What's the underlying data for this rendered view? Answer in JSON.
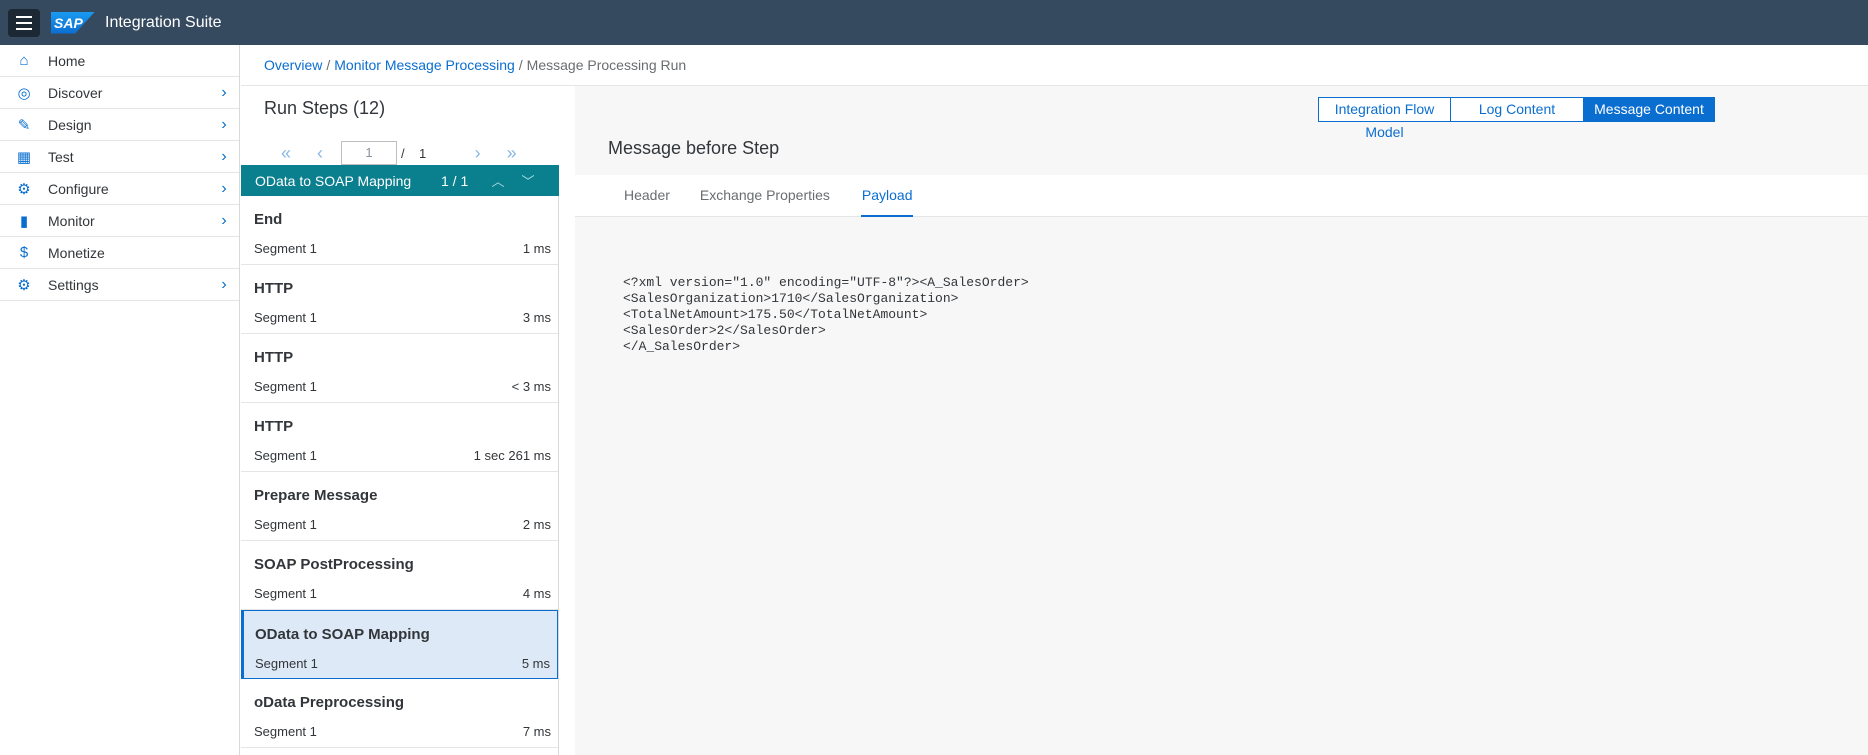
{
  "shell": {
    "title": "Integration Suite",
    "logo_text": "SAP"
  },
  "sidenav": {
    "items": [
      {
        "label": "Home",
        "icon": "home-icon",
        "glyph": "⌂",
        "chevron": false
      },
      {
        "label": "Discover",
        "icon": "compass-icon",
        "glyph": "◎",
        "chevron": true
      },
      {
        "label": "Design",
        "icon": "pencil-icon",
        "glyph": "✎",
        "chevron": true
      },
      {
        "label": "Test",
        "icon": "calculator-icon",
        "glyph": "▦",
        "chevron": true
      },
      {
        "label": "Configure",
        "icon": "sliders-icon",
        "glyph": "⚙",
        "chevron": true
      },
      {
        "label": "Monitor",
        "icon": "bar-chart-icon",
        "glyph": "▮",
        "chevron": true
      },
      {
        "label": "Monetize",
        "icon": "dollar-icon",
        "glyph": "$",
        "chevron": false
      },
      {
        "label": "Settings",
        "icon": "gear-icon",
        "glyph": "⚙",
        "chevron": true
      }
    ]
  },
  "breadcrumb": {
    "overview": "Overview",
    "monitor": "Monitor Message Processing",
    "sep": "/",
    "current": "Message Processing Run"
  },
  "steps": {
    "title": "Run Steps (12)",
    "pager": {
      "page_value": "1",
      "slash": "/",
      "total": "1"
    },
    "group": {
      "name": "OData to SOAP Mapping",
      "count": "1 / 1"
    },
    "items": [
      {
        "name": "End",
        "segment": "Segment 1",
        "time": "1 ms"
      },
      {
        "name": "HTTP",
        "segment": "Segment 1",
        "time": "3 ms"
      },
      {
        "name": "HTTP",
        "segment": "Segment 1",
        "time": "< 3 ms"
      },
      {
        "name": "HTTP",
        "segment": "Segment 1",
        "time": "1 sec 261 ms"
      },
      {
        "name": "Prepare Message",
        "segment": "Segment 1",
        "time": "2 ms"
      },
      {
        "name": "SOAP PostProcessing",
        "segment": "Segment 1",
        "time": "4 ms"
      },
      {
        "name": "OData to SOAP Mapping",
        "segment": "Segment 1",
        "time": "5 ms",
        "selected": true
      },
      {
        "name": "oData Preprocessing",
        "segment": "Segment 1",
        "time": "7 ms"
      }
    ]
  },
  "content": {
    "view_buttons": [
      "Integration Flow Model",
      "Log Content",
      "Message Content"
    ],
    "active_view": "Message Content",
    "message_title": "Message before Step",
    "tabs": [
      "Header",
      "Exchange Properties",
      "Payload"
    ],
    "active_tab": "Payload",
    "payload": "<?xml version=\"1.0\" encoding=\"UTF-8\"?><A_SalesOrder>\n<SalesOrganization>1710</SalesOrganization>\n<TotalNetAmount>175.50</TotalNetAmount>\n<SalesOrder>2</SalesOrder>\n</A_SalesOrder>"
  },
  "colors": {
    "shell": "#354a5f",
    "accent": "#0a6ed1",
    "group": "#0a7f8e",
    "selected": "#dde9f7"
  }
}
